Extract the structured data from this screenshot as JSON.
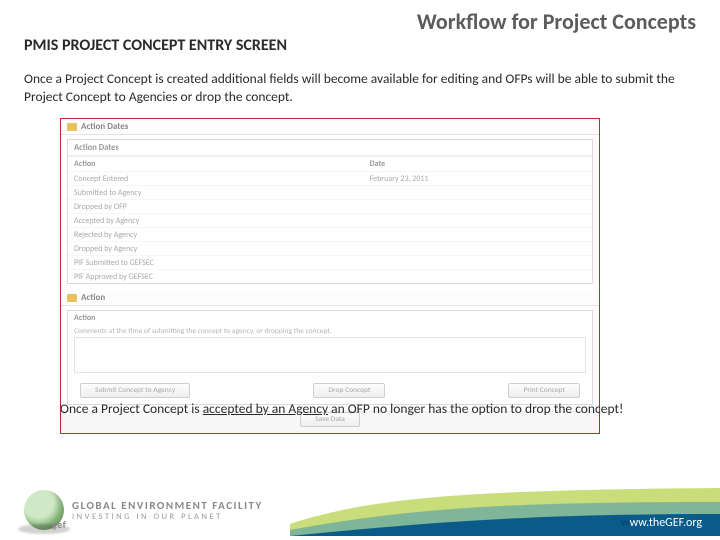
{
  "slide": {
    "title": "Workflow for Project Concepts",
    "section_title": "PMIS PROJECT CONCEPT ENTRY SCREEN",
    "intro": "Once a Project Concept is created additional fields will become available for editing and OFPs will be able to submit the Project Concept to Agencies or drop the concept.",
    "closing_pre": "Once a Project Concept is ",
    "closing_underlined": "accepted by an Agency",
    "closing_post": " an OFP no longer has the option to drop the concept!"
  },
  "screenshot": {
    "panel1_title": "Action Dates",
    "inner1_title": "Action Dates",
    "col_action": "Action",
    "col_date": "Date",
    "rows": [
      {
        "action": "Concept Entered",
        "date": "February 23, 2011"
      },
      {
        "action": "Submitted to Agency",
        "date": ""
      },
      {
        "action": "Dropped by OFP",
        "date": ""
      },
      {
        "action": "Accepted by Agency",
        "date": ""
      },
      {
        "action": "Rejected by Agency",
        "date": ""
      },
      {
        "action": "Dropped by Agency",
        "date": ""
      },
      {
        "action": "PIF Submitted to GEFSEC",
        "date": ""
      },
      {
        "action": "PIF Approved by GEFSEC",
        "date": ""
      }
    ],
    "panel2_title": "Action",
    "action_sub": "Action",
    "comment_label": "Comments at the time of submitting the concept to agency, or dropping the concept.",
    "btn_submit": "Submit Concept to Agency",
    "btn_drop": "Drop Concept",
    "btn_print": "Print Concept",
    "btn_save": "Save Data"
  },
  "footer": {
    "brand_line1": "GLOBAL ENVIRONMENT FACILITY",
    "brand_line2": "INVESTING IN OUR PLANET",
    "gef": "gef",
    "url_w": "w",
    "url_rest": "ww.theGEF.org"
  }
}
